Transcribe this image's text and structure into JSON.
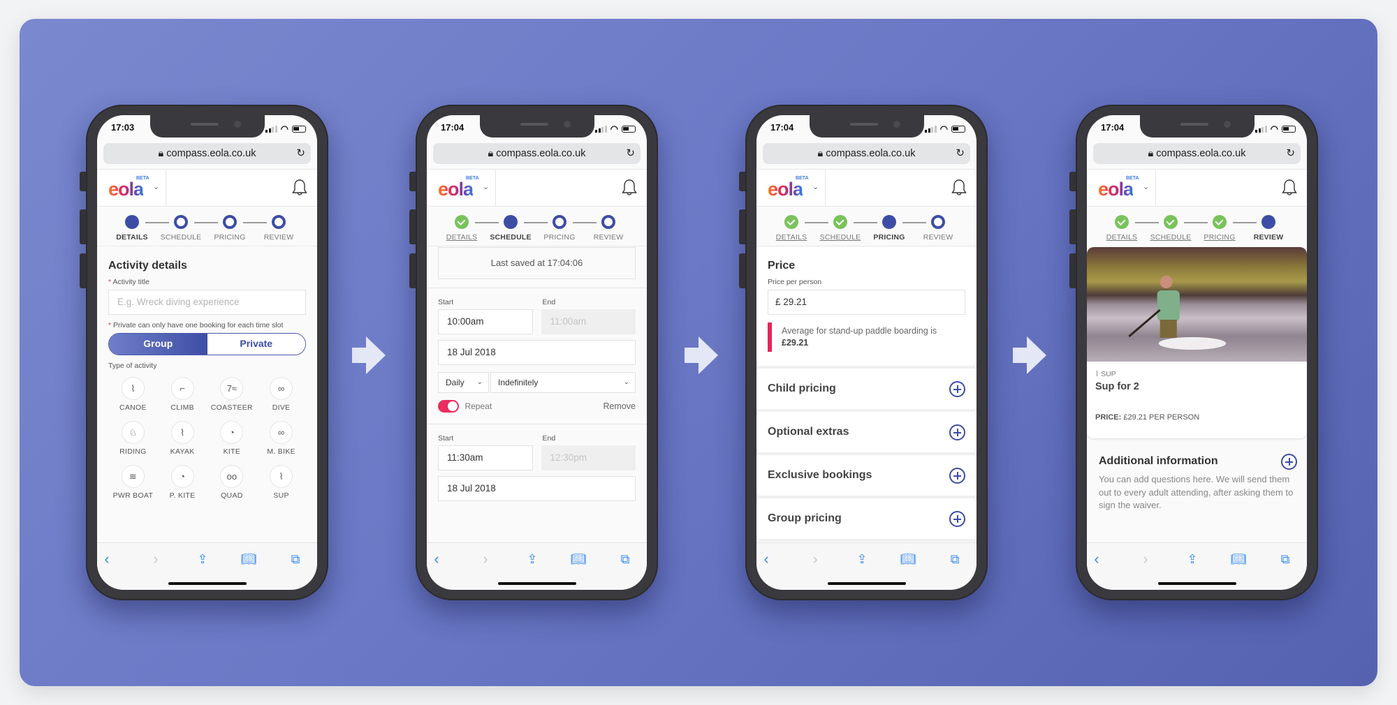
{
  "colors": {
    "background": "#6b79c6",
    "brand_primary": "#3d4da6",
    "success": "#79c35b",
    "accent_pink": "#ea2c5f",
    "ios_blue": "#3b8ef0"
  },
  "browser": {
    "url": "compass.eola.co.uk",
    "lock_icon": "lock-icon",
    "reload_icon": "reload-icon"
  },
  "app": {
    "logo_text": "eola",
    "logo_badge": "BETA",
    "bell_icon": "bell-icon"
  },
  "steps": [
    "DETAILS",
    "SCHEDULE",
    "PRICING",
    "REVIEW"
  ],
  "screens": [
    {
      "status_time": "17:03",
      "current_step": 0,
      "title": "Activity details",
      "activity_title_label": "Activity title",
      "activity_title_placeholder": "E.g. Wreck diving experience",
      "private_note": "Private can only have one booking for each time slot",
      "booking_type": {
        "options": [
          "Group",
          "Private"
        ],
        "selected": "Group"
      },
      "type_label": "Type of activity",
      "activities": [
        {
          "label": "CANOE",
          "icon": "canoe-icon",
          "glyph": "⌇"
        },
        {
          "label": "CLIMB",
          "icon": "climb-icon",
          "glyph": "⌐"
        },
        {
          "label": "COASTEER",
          "icon": "coasteer-icon",
          "glyph": "7≈"
        },
        {
          "label": "DIVE",
          "icon": "dive-mask-icon",
          "glyph": "∞"
        },
        {
          "label": "RIDING",
          "icon": "horse-icon",
          "glyph": "♘"
        },
        {
          "label": "KAYAK",
          "icon": "kayak-icon",
          "glyph": "⌇"
        },
        {
          "label": "KITE",
          "icon": "kite-icon",
          "glyph": "◔"
        },
        {
          "label": "M. BIKE",
          "icon": "bike-icon",
          "glyph": "∞"
        },
        {
          "label": "PWR BOAT",
          "icon": "powerboat-icon",
          "glyph": "≋"
        },
        {
          "label": "P. KITE",
          "icon": "power-kite-icon",
          "glyph": "◔"
        },
        {
          "label": "QUAD",
          "icon": "quad-icon",
          "glyph": "oo"
        },
        {
          "label": "SUP",
          "icon": "sup-icon",
          "glyph": "⌇"
        }
      ]
    },
    {
      "status_time": "17:04",
      "current_step": 1,
      "last_saved": "Last saved at 17:04:06",
      "start_label": "Start",
      "end_label": "End",
      "slots": [
        {
          "start": "10:00am",
          "end": "11:00am",
          "date": "18 Jul 2018",
          "frequency": "Daily",
          "until": "Indefinitely",
          "repeat_label": "Repeat",
          "repeat_on": true,
          "remove_label": "Remove"
        },
        {
          "start": "11:30am",
          "end": "12:30pm",
          "date": "18 Jul 2018"
        }
      ]
    },
    {
      "status_time": "17:04",
      "current_step": 2,
      "title": "Price",
      "price_label": "Price per person",
      "currency": "£",
      "price_value": "29.21",
      "hint_text": "Average for stand-up paddle boarding is",
      "hint_value": "£29.21",
      "sections": [
        "Child pricing",
        "Optional extras",
        "Exclusive bookings",
        "Group pricing"
      ]
    },
    {
      "status_time": "17:04",
      "current_step": 3,
      "category": "SUP",
      "activity_name": "Sup for 2",
      "price_label": "PRICE:",
      "price_text": "£29.21 PER PERSON",
      "additional_title": "Additional information",
      "additional_text": "You can add questions here. We will send them out to every adult attending, after asking them to sign the waiver."
    }
  ],
  "toolbar": [
    "back-icon",
    "forward-icon",
    "share-icon",
    "bookmarks-icon",
    "tabs-icon"
  ]
}
